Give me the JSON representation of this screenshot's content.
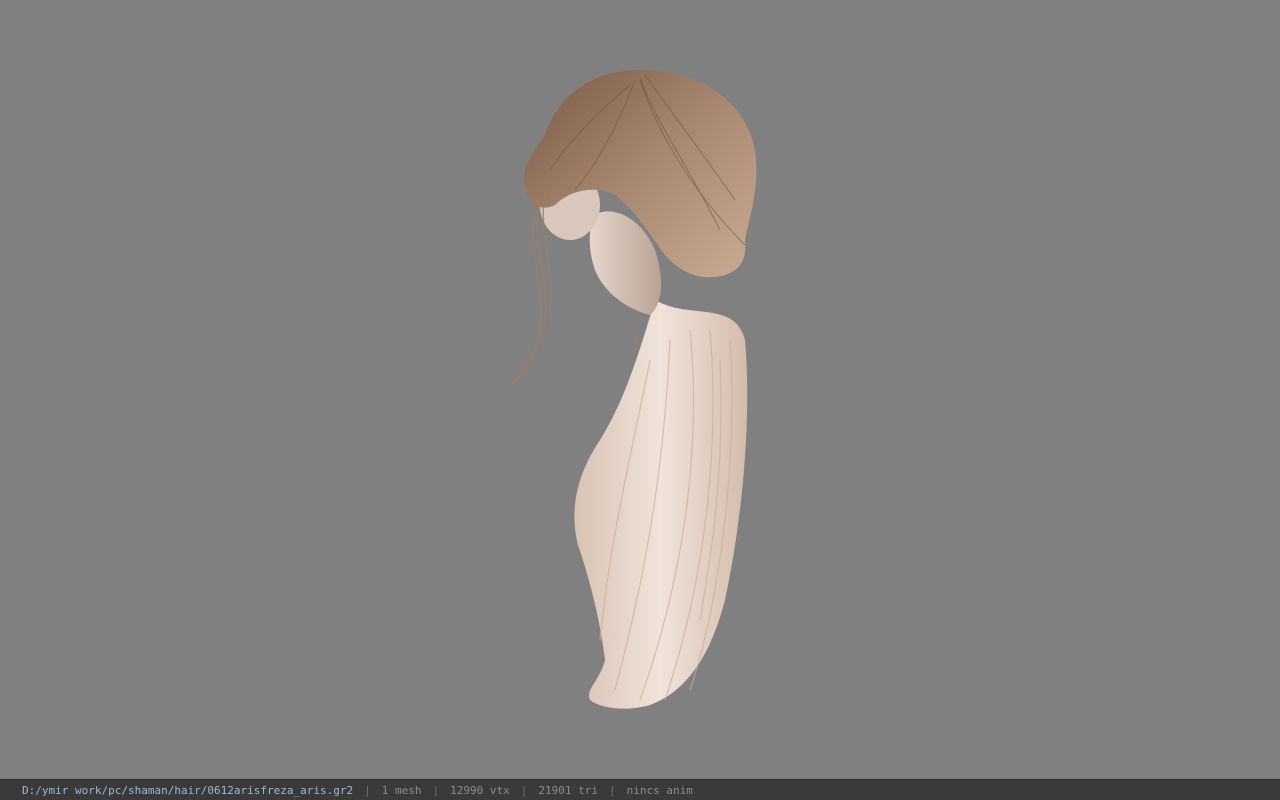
{
  "viewer": {
    "background_color": "#808080",
    "model_icon": "hair-mesh-icon"
  },
  "status_bar": {
    "file_path": "D:/ymir work/pc/shaman/hair/0612arisfreza_aris.gr2",
    "separator": "|",
    "mesh_count": "1 mesh",
    "vertex_count": "12990 vtx",
    "triangle_count": "21901 tri",
    "animation": "nincs anim",
    "path_color": "#9fb7d4",
    "text_color": "#8c8c8c"
  }
}
